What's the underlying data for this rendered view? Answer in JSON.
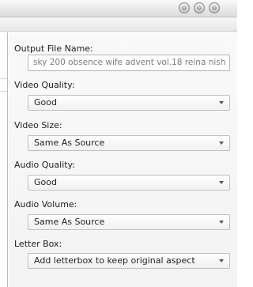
{
  "window": {
    "controls": [
      {
        "name": "window-button-1-icon"
      },
      {
        "name": "window-button-2-icon"
      },
      {
        "name": "window-button-3-icon"
      }
    ]
  },
  "settings": {
    "output_file_name": {
      "label": "Output File Name:",
      "value": "sky 200 obsence wife advent vol.18 reina nish"
    },
    "video_quality": {
      "label": "Video Quality:",
      "selected": "Good"
    },
    "video_size": {
      "label": "Video Size:",
      "selected": "Same As Source"
    },
    "audio_quality": {
      "label": "Audio Quality:",
      "selected": "Good"
    },
    "audio_volume": {
      "label": "Audio Volume:",
      "selected": "Same As Source"
    },
    "letter_box": {
      "label": "Letter Box:",
      "selected": "Add letterbox to keep original aspect"
    }
  },
  "colors": {
    "panel_background": "#f3f3f3",
    "text": "#1e1e1e",
    "field_text": "#7d7d7d",
    "border": "#b4b4b4"
  }
}
